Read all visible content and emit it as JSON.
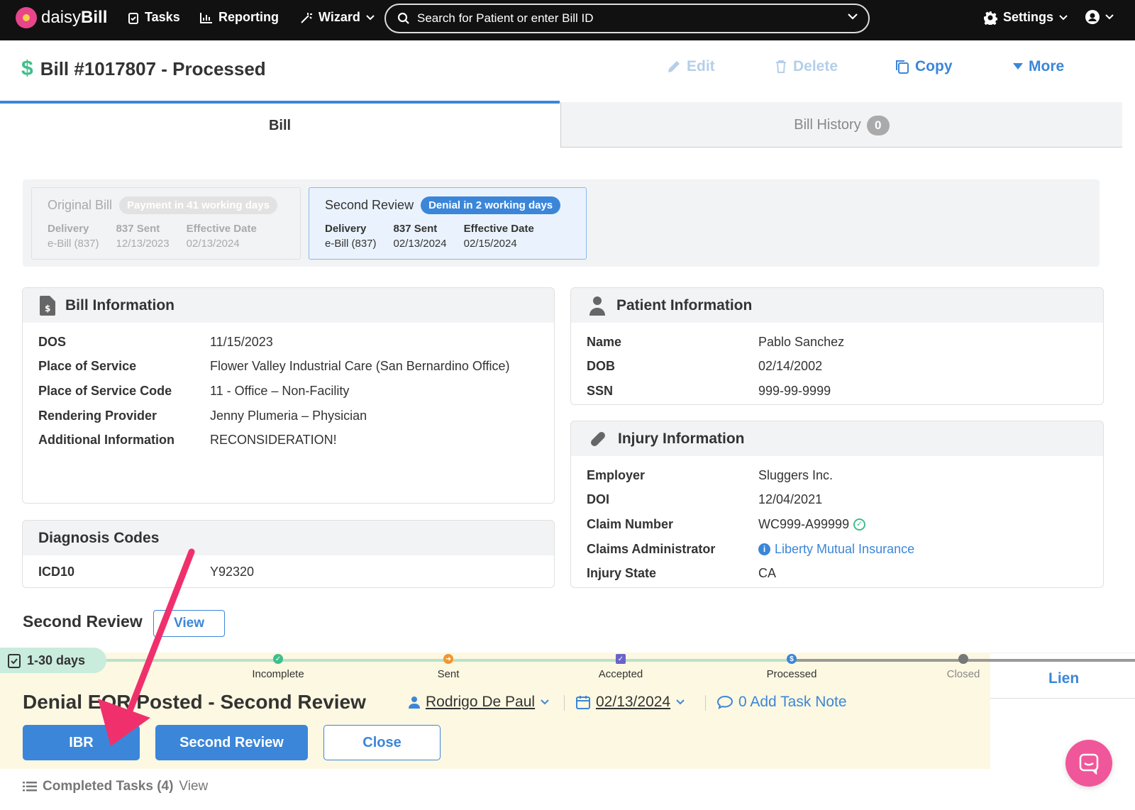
{
  "nav": {
    "logo_prefix": "daisy",
    "logo_suffix": "Bill",
    "tasks": "Tasks",
    "reporting": "Reporting",
    "wizard": "Wizard",
    "search_placeholder": "Search for Patient or enter Bill ID",
    "settings": "Settings"
  },
  "header": {
    "title": "Bill #1017807 - Processed",
    "edit": "Edit",
    "delete": "Delete",
    "copy": "Copy",
    "more": "More"
  },
  "tabs": {
    "bill": "Bill",
    "history": "Bill History",
    "history_count": "0"
  },
  "versions": {
    "original": {
      "title": "Original Bill",
      "status": "Payment in 41 working days",
      "delivery_label": "Delivery",
      "delivery": "e-Bill (837)",
      "sent_label": "837 Sent",
      "sent": "12/13/2023",
      "effective_label": "Effective Date",
      "effective": "02/13/2024"
    },
    "second": {
      "title": "Second Review",
      "status": "Denial in 2 working days",
      "delivery_label": "Delivery",
      "delivery": "e-Bill (837)",
      "sent_label": "837 Sent",
      "sent": "02/13/2024",
      "effective_label": "Effective Date",
      "effective": "02/15/2024"
    }
  },
  "bill_info": {
    "title": "Bill Information",
    "rows": [
      {
        "k": "DOS",
        "v": "11/15/2023"
      },
      {
        "k": "Place of Service",
        "v": "Flower Valley Industrial Care (San Bernardino Office)"
      },
      {
        "k": "Place of Service Code",
        "v": "11 - Office – Non-Facility"
      },
      {
        "k": "Rendering Provider",
        "v": "Jenny Plumeria – Physician"
      },
      {
        "k": "Additional Information",
        "v": "RECONSIDERATION!"
      }
    ]
  },
  "diagnosis": {
    "title": "Diagnosis Codes",
    "rows": [
      {
        "k": "ICD10",
        "v": "Y92320"
      }
    ]
  },
  "patient_info": {
    "title": "Patient Information",
    "rows": [
      {
        "k": "Name",
        "v": "Pablo Sanchez"
      },
      {
        "k": "DOB",
        "v": "02/14/2002"
      },
      {
        "k": "SSN",
        "v": "999-99-9999"
      }
    ]
  },
  "injury_info": {
    "title": "Injury Information",
    "rows": [
      {
        "k": "Employer",
        "v": "Sluggers Inc."
      },
      {
        "k": "DOI",
        "v": "12/04/2021"
      },
      {
        "k": "Claim Number",
        "v": "WC999-A99999"
      },
      {
        "k": "Claims Administrator",
        "v": "Liberty Mutual Insurance"
      },
      {
        "k": "Injury State",
        "v": "CA"
      }
    ]
  },
  "second_review": {
    "title": "Second Review",
    "view": "View"
  },
  "task": {
    "days": "1-30 days",
    "stages": [
      "Incomplete",
      "Sent",
      "Accepted",
      "Processed",
      "Closed"
    ],
    "title": "Denial EOR Posted - Second Review",
    "assignee": "Rodrigo De Paul",
    "date": "02/13/2024",
    "note": "0 Add Task Note",
    "btn_ibr": "IBR",
    "btn_second": "Second Review",
    "btn_close": "Close",
    "lien": "Lien"
  },
  "completed": {
    "label": "Completed Tasks (4)",
    "view": "View"
  },
  "colors": {
    "accent": "#3b86d9",
    "brand": "#e8458b",
    "arrow": "#f0306c"
  }
}
